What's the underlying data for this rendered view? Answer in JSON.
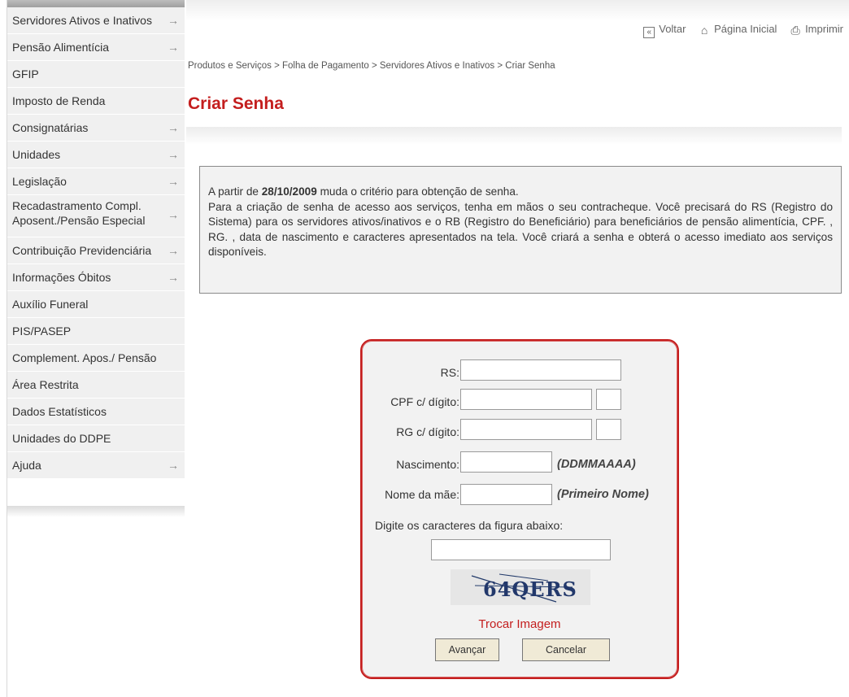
{
  "sidebar": {
    "items": [
      {
        "label": "Servidores Ativos e Inativos",
        "arrow": "→"
      },
      {
        "label": "Pensão Alimentícia",
        "arrow": "→"
      },
      {
        "label": "GFIP",
        "arrow": ""
      },
      {
        "label": "Imposto de Renda",
        "arrow": ""
      },
      {
        "label": "Consignatárias",
        "arrow": "→"
      },
      {
        "label": "Unidades",
        "arrow": "→"
      },
      {
        "label": "Legislação",
        "arrow": "→"
      },
      {
        "label": "Recadastramento Compl. Aposent./Pensão Especial",
        "arrow": "→"
      },
      {
        "label": "Contribuição Previdenciária",
        "arrow": "→"
      },
      {
        "label": "Informações Óbitos",
        "arrow": "→"
      },
      {
        "label": "Auxílio Funeral",
        "arrow": ""
      },
      {
        "label": "PIS/PASEP",
        "arrow": ""
      },
      {
        "label": "Complement. Apos./ Pensão",
        "arrow": ""
      },
      {
        "label": "Área Restrita",
        "arrow": ""
      },
      {
        "label": "Dados Estatísticos",
        "arrow": ""
      },
      {
        "label": "Unidades do DDPE",
        "arrow": ""
      },
      {
        "label": "Ajuda",
        "arrow": "→"
      }
    ]
  },
  "toplinks": {
    "back_icon": "«",
    "back": "Voltar",
    "home_icon": "⌂",
    "home": "Página Inicial",
    "print_icon": "⎙",
    "print": "Imprimir"
  },
  "breadcrumb": "Produtos e Serviços > Folha de Pagamento > Servidores Ativos e Inativos > Criar Senha",
  "page_title": "Criar Senha",
  "notice": {
    "line1_prefix": "A partir de ",
    "line1_date": "28/10/2009",
    "line1_suffix": " muda o critério para obtenção de senha.",
    "body": "Para a criação de senha de acesso aos serviços, tenha em mãos o seu contracheque. Você precisará do RS (Registro do Sistema) para os servidores ativos/inativos e o RB (Registro do Beneficiário) para beneficiários de pensão alimentícia, CPF. , RG. , data de nascimento e caracteres apresentados na tela. Você criará a senha e obterá o acesso imediato aos serviços disponíveis."
  },
  "form": {
    "rs_label": "RS:",
    "cpf_label": "CPF c/ dígito:",
    "rg_label": "RG c/ dígito:",
    "nascimento_label": "Nascimento:",
    "nascimento_hint": "(DDMMAAAA)",
    "mae_label": "Nome da mãe:",
    "mae_hint": "(Primeiro Nome)",
    "captcha_label": "Digite os caracteres da figura abaixo:",
    "captcha_text": "64QERS",
    "trocar": "Trocar Imagem",
    "avancar": "Avançar",
    "cancelar": "Cancelar"
  },
  "colors": {
    "accent": "#c41e1e",
    "sidebar_bg": "#f0f0f0",
    "panel_bg": "#f2f2f2"
  }
}
